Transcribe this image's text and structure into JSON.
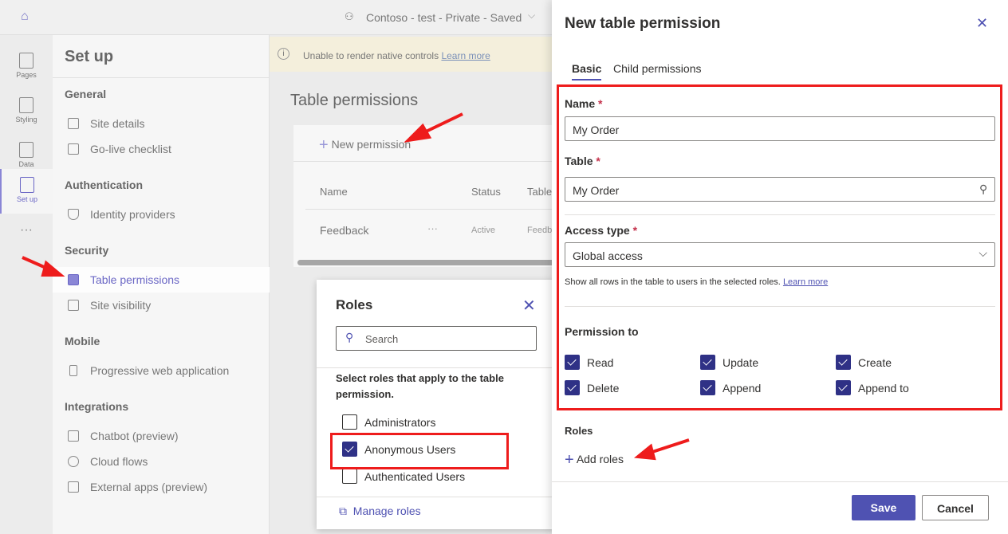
{
  "topbar": {
    "site_title": "Contoso - test - Private - Saved"
  },
  "rail": [
    {
      "label": "Pages"
    },
    {
      "label": "Styling"
    },
    {
      "label": "Data"
    },
    {
      "label": "Set up"
    }
  ],
  "nav": {
    "title": "Set up",
    "sections": [
      {
        "label": "General",
        "items": [
          "Site details",
          "Go-live checklist"
        ]
      },
      {
        "label": "Authentication",
        "items": [
          "Identity providers"
        ]
      },
      {
        "label": "Security",
        "items": [
          "Table permissions",
          "Site visibility"
        ]
      },
      {
        "label": "Mobile",
        "items": [
          "Progressive web application"
        ]
      },
      {
        "label": "Integrations",
        "items": [
          "Chatbot (preview)",
          "Cloud flows",
          "External apps (preview)"
        ]
      }
    ],
    "active": "Table permissions"
  },
  "banner": {
    "text": "Unable to render native controls",
    "link": "Learn more"
  },
  "content": {
    "title": "Table permissions",
    "new_permission": "New permission",
    "columns": [
      "Name",
      "Status",
      "Table"
    ],
    "rows": [
      {
        "name": "Feedback",
        "more": "···",
        "status": "Active",
        "table": "Feedb"
      }
    ]
  },
  "roles_popup": {
    "title": "Roles",
    "search_placeholder": "Search",
    "instruction": "Select roles that apply to the table permission.",
    "roles": [
      {
        "label": "Administrators",
        "checked": false
      },
      {
        "label": "Anonymous Users",
        "checked": true
      },
      {
        "label": "Authenticated Users",
        "checked": false
      }
    ],
    "manage": "Manage roles"
  },
  "panel": {
    "title": "New table permission",
    "tabs": [
      "Basic",
      "Child permissions"
    ],
    "active_tab": "Basic",
    "name_label": "Name",
    "name_value": "My Order",
    "table_label": "Table",
    "table_value": "My Order",
    "access_label": "Access type",
    "access_value": "Global access",
    "access_help": "Show all rows in the table to users in the selected roles.",
    "access_help_link": "Learn more",
    "permission_label": "Permission to",
    "permissions": [
      {
        "label": "Read",
        "checked": true
      },
      {
        "label": "Update",
        "checked": true
      },
      {
        "label": "Create",
        "checked": true
      },
      {
        "label": "Delete",
        "checked": true
      },
      {
        "label": "Append",
        "checked": true
      },
      {
        "label": "Append to",
        "checked": true
      }
    ],
    "roles_label": "Roles",
    "add_roles": "Add roles",
    "save": "Save",
    "cancel": "Cancel",
    "required_mark": "*"
  },
  "colors": {
    "accent": "#2f3186",
    "annotation": "#ee1c1c",
    "link": "#4f52b2"
  }
}
